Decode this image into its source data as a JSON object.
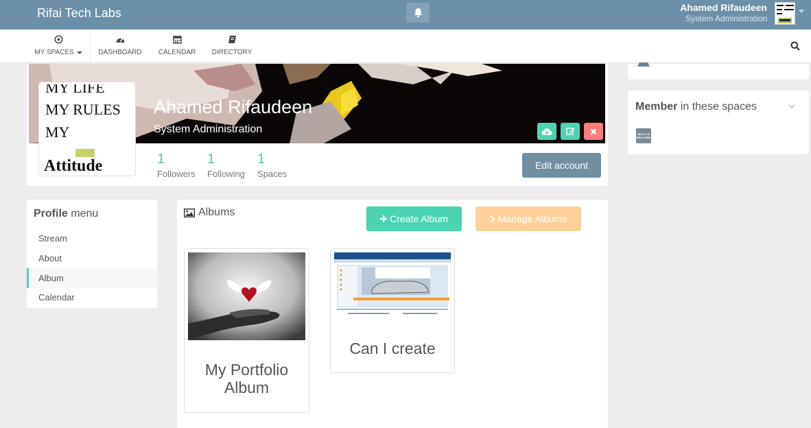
{
  "app": {
    "brand": "Rifai Tech Labs"
  },
  "user": {
    "name": "Ahamed Rifaudeen",
    "role": "System Administration"
  },
  "nav": {
    "items": [
      {
        "label": "MY SPACES",
        "icon": "target-icon"
      },
      {
        "label": "DASHBOARD",
        "icon": "dashboard-icon"
      },
      {
        "label": "CALENDAR",
        "icon": "calendar-icon"
      },
      {
        "label": "DIRECTORY",
        "icon": "book-icon"
      }
    ]
  },
  "profile": {
    "name": "Ahamed Rifaudeen",
    "role": "System Administration",
    "avatar_text": [
      "MY LIFE",
      "MY RULES",
      "MY",
      "Attitude"
    ],
    "stats": [
      {
        "value": "1",
        "label": "Followers"
      },
      {
        "value": "1",
        "label": "Following"
      },
      {
        "value": "1",
        "label": "Spaces"
      }
    ],
    "edit_label": "Edit account"
  },
  "member_panel": {
    "title_bold": "Member",
    "title_rest": " in these spaces",
    "space_icon_text": "HELLO & WELCOME"
  },
  "profile_menu": {
    "title_bold": "Profile",
    "title_rest": " menu",
    "items": [
      "Stream",
      "About",
      "Album",
      "Calendar"
    ],
    "active": "Album"
  },
  "albums": {
    "title": "Albums",
    "create_label": "Create Album",
    "manage_label": "Manage Albums",
    "list": [
      {
        "name": "My Portfolio Album"
      },
      {
        "name": "Can I create"
      }
    ]
  },
  "colors": {
    "topbar": "#6d8fa7",
    "accent": "#4cd4b2",
    "warning": "#fdd197",
    "danger": "#fb7d7d",
    "edit": "#708fa0"
  }
}
